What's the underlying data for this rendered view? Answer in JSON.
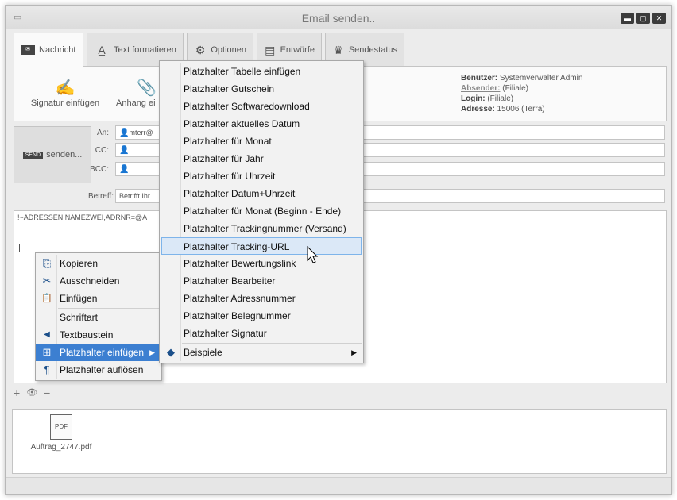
{
  "window": {
    "title": "Email senden..",
    "controls": {
      "minimize": "▬",
      "maximize": "▢",
      "close": "✕"
    }
  },
  "tabs": [
    {
      "label": "Nachricht",
      "icon": "message-icon",
      "active": true
    },
    {
      "label": "Text formatieren",
      "icon": "font-icon"
    },
    {
      "label": "Optionen",
      "icon": "gears-icon"
    },
    {
      "label": "Entwürfe",
      "icon": "drafts-icon"
    },
    {
      "label": "Sendestatus",
      "icon": "send-status-icon"
    }
  ],
  "ribbon": {
    "signature_label": "Signatur einfügen",
    "attachment_label": "Anhang ei"
  },
  "user_info": {
    "benutzer_label": "Benutzer:",
    "benutzer_value": "Systemverwalter Admin",
    "absender_label": "Absender:",
    "absender_value": "(Filiale)",
    "login_label": "Login:",
    "login_value": "(Filiale)",
    "adresse_label": "Adresse:",
    "adresse_value": "15006 (Terra)"
  },
  "compose": {
    "send_label": "senden...",
    "send_icon_text": "SEND",
    "to_label": "An:",
    "to_value": "mterr@",
    "cc_label": "CC:",
    "bcc_label": "BCC:",
    "subject_label": "Betreff:",
    "subject_value": "Betrifft Ihr",
    "body_line1": "!~ADRESSEN,NAMEZWEI,ADRNR=@A"
  },
  "mini_toolbar": {
    "add": "+",
    "view": "👁",
    "remove": "−"
  },
  "attachments": [
    {
      "name": "Auftrag_2747.pdf",
      "icon_text": "PDF"
    }
  ],
  "context_menu": {
    "items": [
      {
        "label": "Kopieren",
        "icon": "copy-icon",
        "glyph": "⎘"
      },
      {
        "label": "Ausschneiden",
        "icon": "scissors-icon",
        "glyph": "✂"
      },
      {
        "label": "Einfügen",
        "icon": "paste-icon",
        "glyph": "📋"
      },
      {
        "label": "Schriftart",
        "icon": "",
        "glyph": ""
      },
      {
        "label": "Textbaustein",
        "icon": "text-block-icon",
        "glyph": "◀"
      },
      {
        "label": "Platzhalter einfügen",
        "icon": "placeholder-insert-icon",
        "glyph": "⊞"
      },
      {
        "label": "Platzhalter auflösen",
        "icon": "pilcrow-icon",
        "glyph": "¶"
      }
    ]
  },
  "submenu": {
    "items": [
      "Platzhalter Tabelle einfügen",
      "Platzhalter Gutschein",
      "Platzhalter Softwaredownload",
      "Platzhalter aktuelles Datum",
      "Platzhalter für Monat",
      "Platzhalter für Jahr",
      "Platzhalter für Uhrzeit",
      "Platzhalter Datum+Uhrzeit",
      "Platzhalter für Monat (Beginn - Ende)",
      "Platzhalter Trackingnummer (Versand)",
      "Platzhalter Tracking-URL",
      "Platzhalter Bewertungslink",
      "Platzhalter Bearbeiter",
      "Platzhalter Adressnummer",
      "Platzhalter Belegnummer",
      "Platzhalter Signatur"
    ],
    "highlighted": "Platzhalter Tracking-URL",
    "examples_label": "Beispiele",
    "examples_icon": "shapes-icon"
  },
  "colors": {
    "highlight": "#dbe8f7",
    "highlight_border": "#7eb4ea",
    "selected": "#3c7fd1"
  }
}
